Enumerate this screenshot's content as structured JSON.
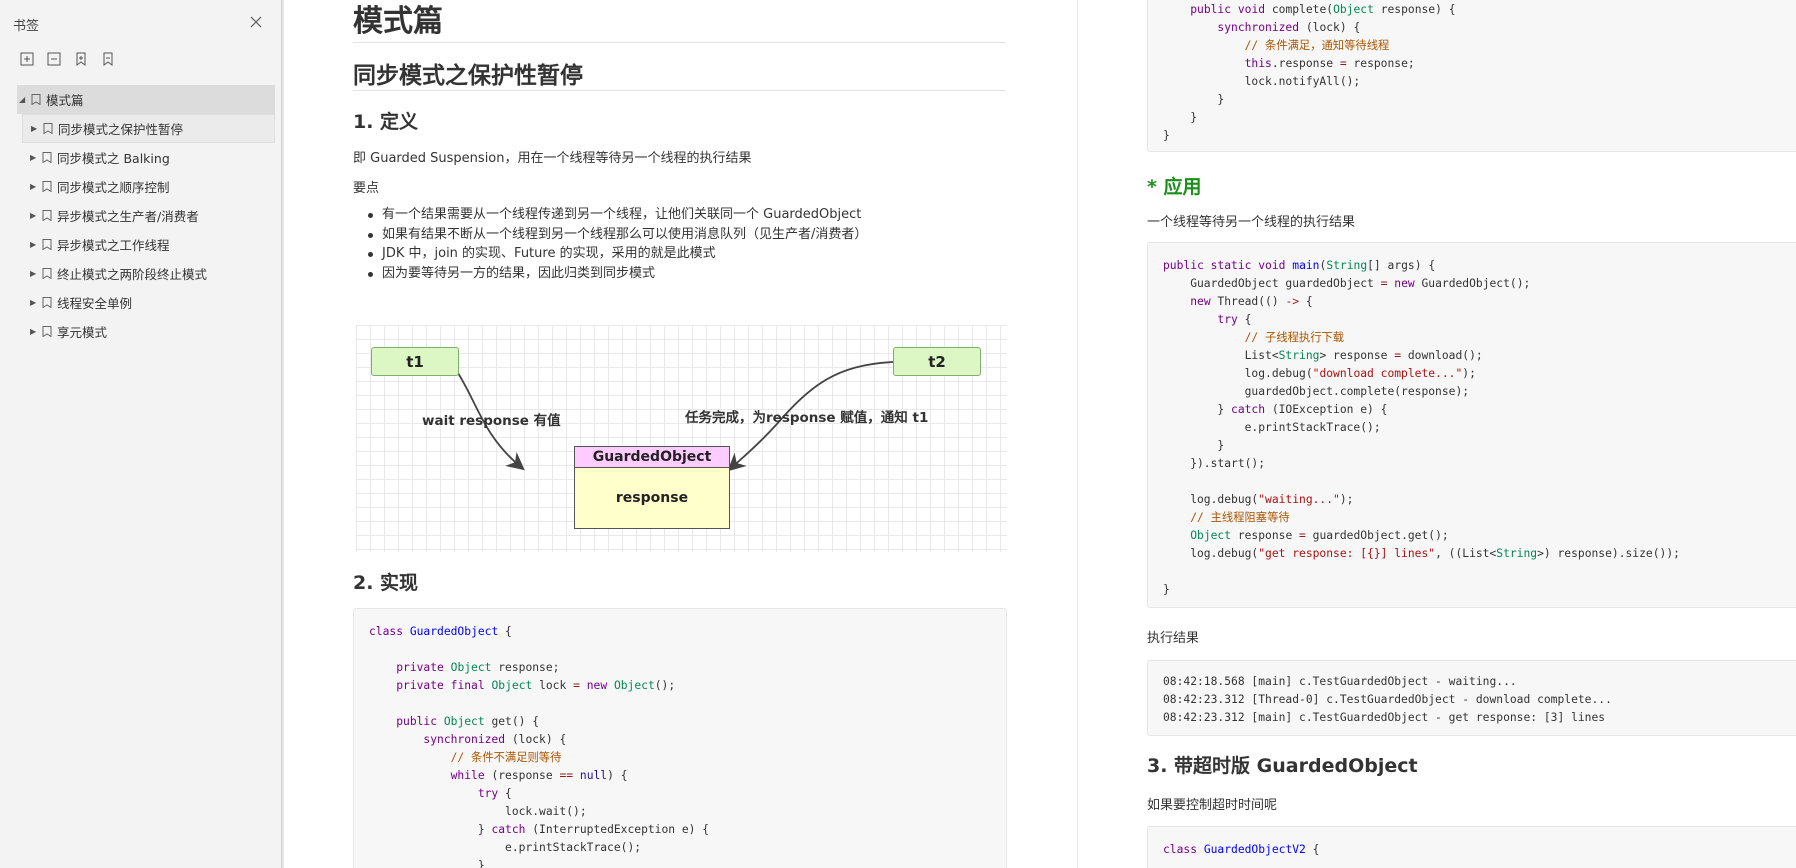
{
  "sidebar": {
    "title": "书签",
    "items": [
      {
        "label": "模式篇"
      },
      {
        "label": "同步模式之保护性暂停"
      },
      {
        "label": "同步模式之 Balking"
      },
      {
        "label": "同步模式之顺序控制"
      },
      {
        "label": "异步模式之生产者/消费者"
      },
      {
        "label": "异步模式之工作线程"
      },
      {
        "label": "终止模式之两阶段终止模式"
      },
      {
        "label": "线程安全单例"
      },
      {
        "label": "享元模式"
      }
    ]
  },
  "left": {
    "h1": "模式篇",
    "h2": "同步模式之保护性暂停",
    "h3_def": "1. 定义",
    "def_text": "即 Guarded Suspension，用在一个线程等待另一个线程的执行结果",
    "points_title": "要点",
    "points": [
      "有一个结果需要从一个线程传递到另一个线程，让他们关联同一个 GuardedObject",
      "如果有结果不断从一个线程到另一个线程那么可以使用消息队列（见生产者/消费者）",
      "JDK 中，join 的实现、Future 的实现，采用的就是此模式",
      "因为要等待另一方的结果，因此归类到同步模式"
    ],
    "diagram": {
      "t1": "t1",
      "t2": "t2",
      "label_left": "wait response 有值",
      "label_right": "任务完成，为response 赋值，通知 t1",
      "object_title": "GuardedObject",
      "object_field": "response"
    },
    "h3_impl": "2. 实现"
  },
  "right": {
    "h3_apply": "* 应用",
    "apply_text": "一个线程等待另一个线程的执行结果",
    "result_label": "执行结果",
    "result_lines": [
      "08:42:18.568 [main] c.TestGuardedObject - waiting...",
      "08:42:23.312 [Thread-0] c.TestGuardedObject - download complete...",
      "08:42:23.312 [main] c.TestGuardedObject - get response: [3] lines"
    ],
    "h3_timeout": "3. 带超时版 GuardedObject",
    "timeout_text": "如果要控制超时时间呢"
  },
  "colors": {
    "apply_heading": "#1a8f1a",
    "keyword": "#770088",
    "type": "#008855",
    "class_name": "#0000ff",
    "comment": "#aa5500",
    "string": "#aa1111"
  }
}
